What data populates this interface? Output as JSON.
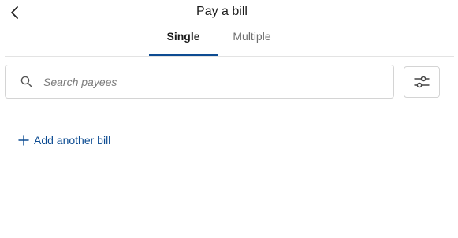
{
  "header": {
    "title": "Pay a bill",
    "back_icon": "chevron-left-icon"
  },
  "tabs": [
    {
      "label": "Single",
      "active": true
    },
    {
      "label": "Multiple",
      "active": false
    }
  ],
  "search": {
    "placeholder": "Search payees",
    "value": "",
    "icon": "search-icon"
  },
  "filter": {
    "icon": "sliders-icon"
  },
  "add_bill": {
    "label": "Add another bill",
    "icon": "plus-icon"
  },
  "colors": {
    "accent": "#0d4c92",
    "border": "#d4d4d4",
    "divider": "#e3e3e3"
  }
}
